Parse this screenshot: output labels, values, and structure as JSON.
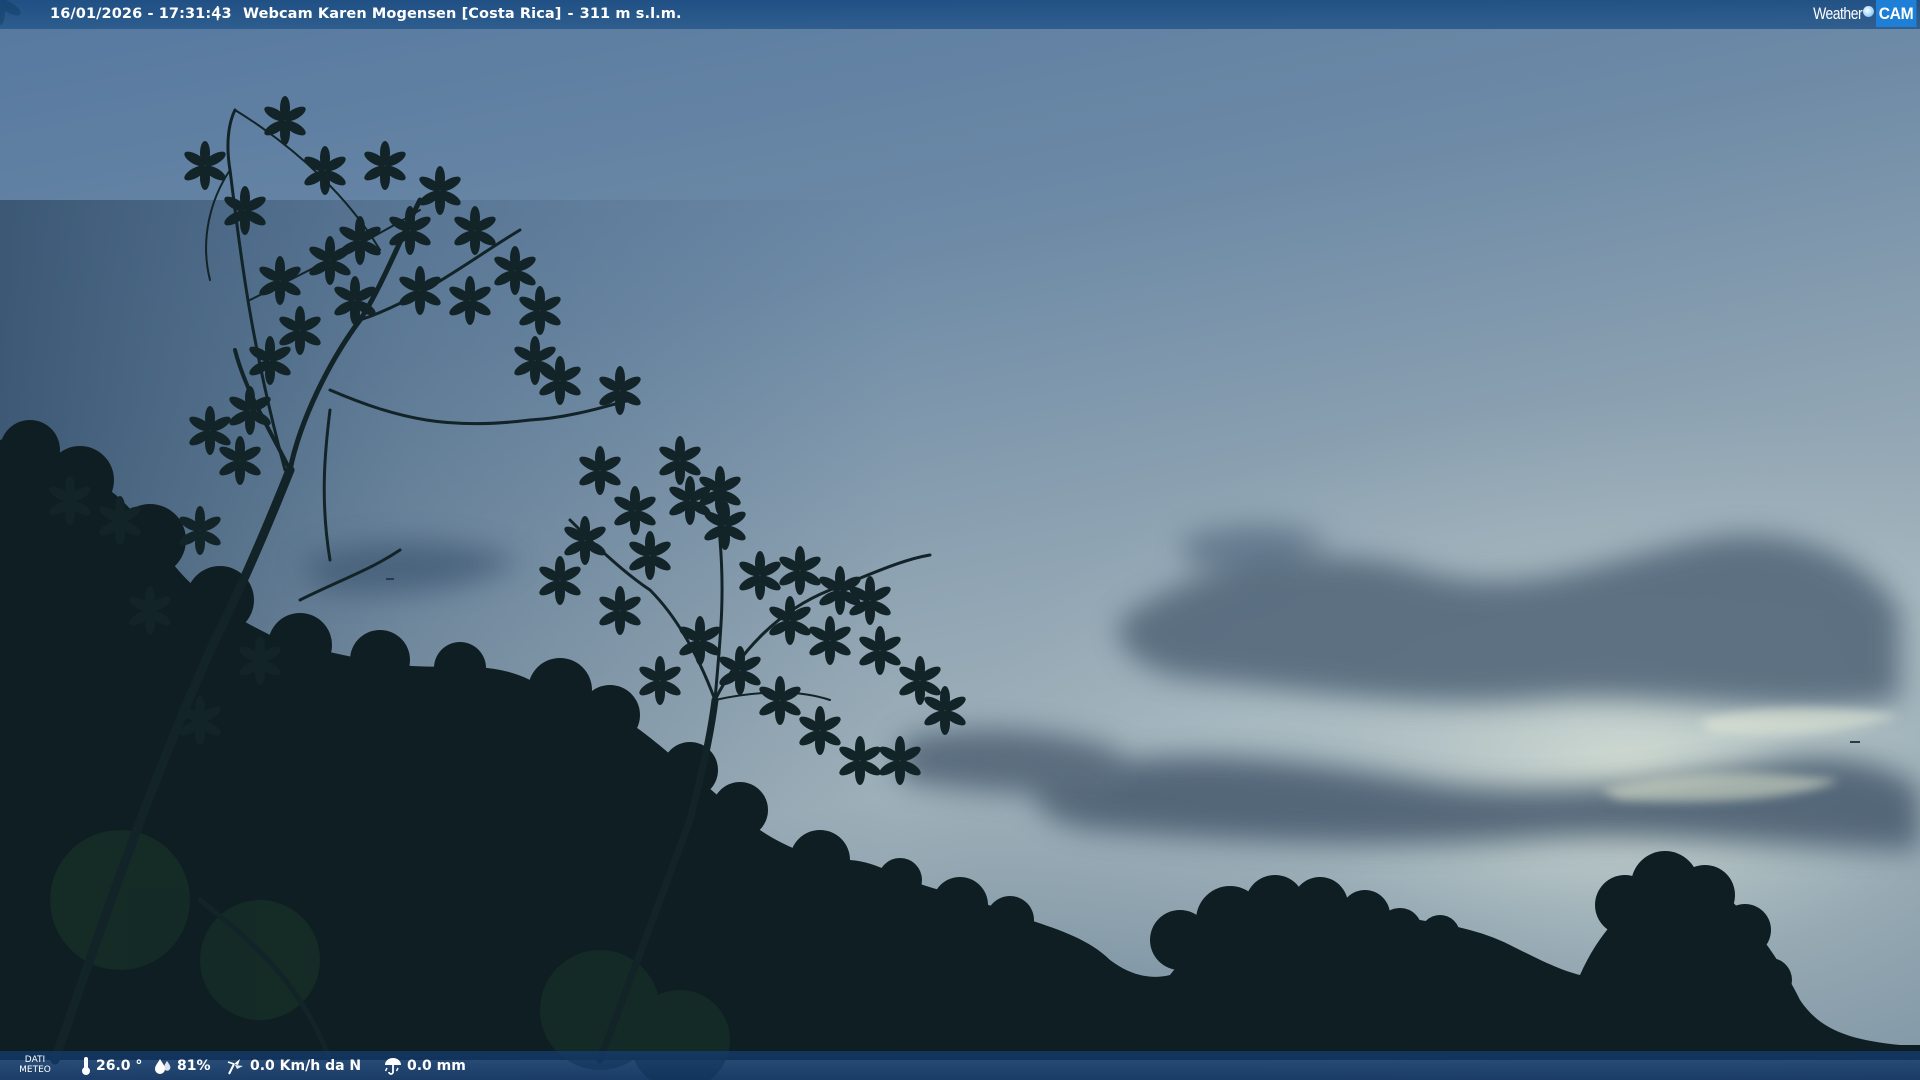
{
  "header": {
    "datetime": "16/01/2026 - 17:31:43",
    "separator": "|",
    "camera_name": "Webcam Karen Mogensen [Costa Rica]",
    "dash": "-",
    "altitude": "311 m s.l.m."
  },
  "logo": {
    "word1": "Weather",
    "word2": "CAM",
    "accent_color": "#1f7fd6"
  },
  "footer": {
    "section_label_line1": "DATI",
    "section_label_line2": "METEO",
    "temperature": "26.0 °",
    "humidity": "81%",
    "wind": "0.0 Km/h da N",
    "rain": "0.0 mm",
    "icons": [
      "thermometer-icon",
      "humidity-icon",
      "wind-icon",
      "rain-icon"
    ]
  },
  "scene": {
    "description_colors": {
      "sky_top": "#5d7b9d",
      "sky_horizon": "#aebfc4",
      "vegetation": "#0f1f22"
    }
  }
}
